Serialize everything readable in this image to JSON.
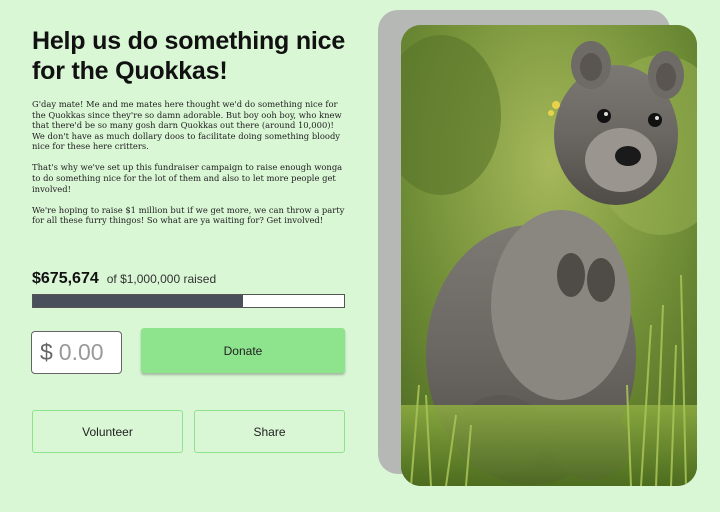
{
  "hero": {
    "title": "Help us do something nice for the Quokkas!",
    "paragraphs": [
      "G'day mate! Me and me mates here thought we'd do something nice for the Quokkas since they're so damn adorable. But boy ooh boy, who knew that there'd be so many gosh darn Quokkas out there (around 10,000)! We don't have as much dollary doos to facilitate doing something bloody nice for these here critters.",
      "That's why we've set up this fundraiser campaign to raise enough wonga to do something nice for the lot of them and also to let more people get involved!",
      "We're hoping to raise $1 million but if we get more, we can throw a party for all these furry thingos! So what are ya waiting for? Get involved!"
    ]
  },
  "fundraiser": {
    "raised": "$675,674",
    "goal_text": "of $1,000,000 raised",
    "progress_fraction": 0.676
  },
  "donation": {
    "currency_symbol": "$",
    "amount_placeholder": "0.00",
    "donate_label": "Donate"
  },
  "actions": {
    "volunteer_label": "Volunteer",
    "share_label": "Share"
  },
  "photo": {
    "subject": "quokka-photo"
  },
  "colors": {
    "background": "#d9f6d5",
    "accent": "#8de48d",
    "progress_fill": "#4a4f5c"
  }
}
